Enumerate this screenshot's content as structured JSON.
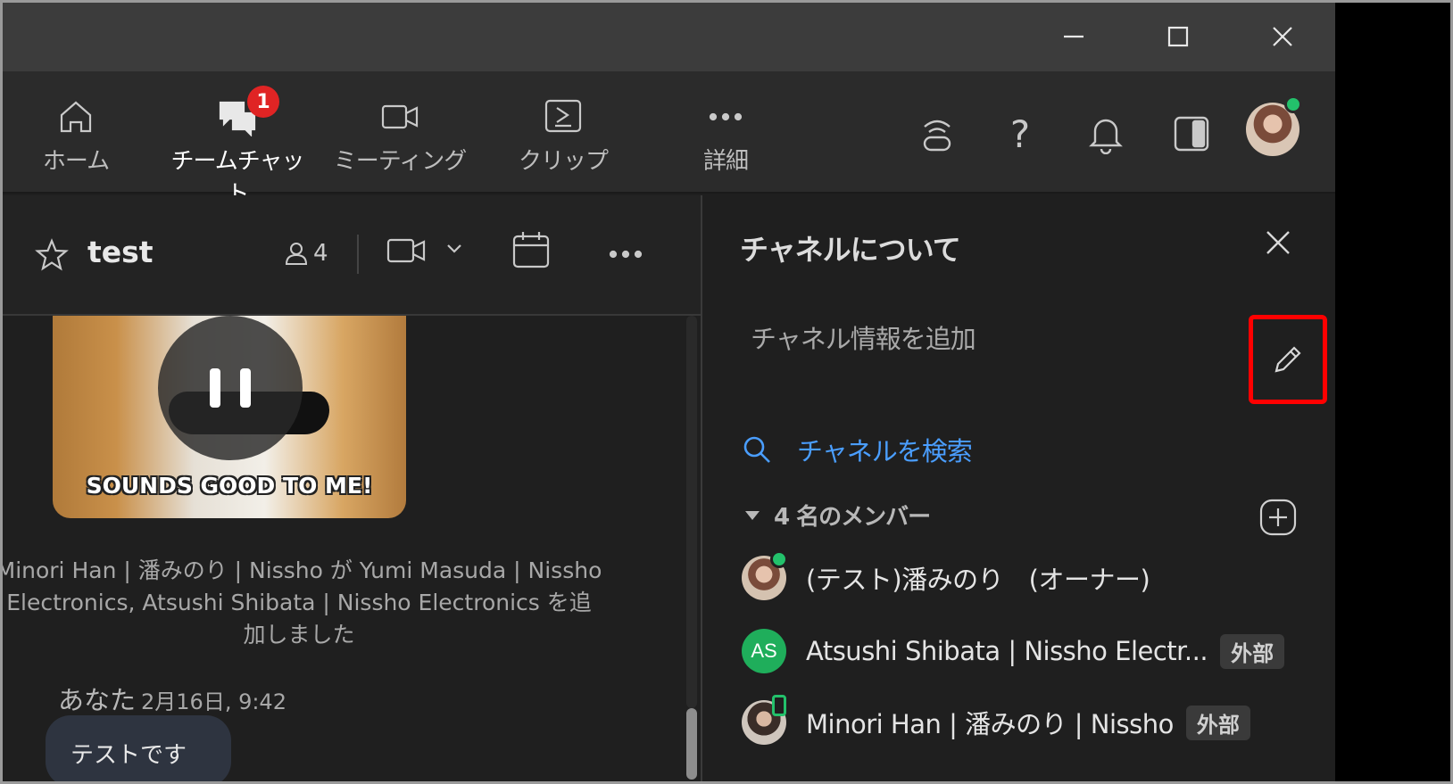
{
  "window_controls": {
    "minimize": "minimize-icon",
    "maximize": "maximize-icon",
    "close": "close-icon"
  },
  "nav": {
    "items": [
      {
        "label": "ホーム",
        "icon": "home-icon"
      },
      {
        "label": "チームチャット",
        "icon": "chat-icon",
        "badge": "1"
      },
      {
        "label": "ミーティング",
        "icon": "video-icon"
      },
      {
        "label": "クリップ",
        "icon": "clip-icon"
      },
      {
        "label": "詳細",
        "icon": "more-icon"
      }
    ],
    "help_glyph": "?"
  },
  "chat": {
    "title": "test",
    "member_count": "4",
    "gif_caption": "SOUNDS GOOD TO ME!",
    "system_message": "Minori Han | 潘みのり | Nissho が Yumi Masuda | Nissho Electronics,  Atsushi Shibata | Nissho Electronics を追加しました",
    "sender": "あなた",
    "timestamp": "2月16日, 9:42",
    "bubble_text": "テストです"
  },
  "side_panel": {
    "title": "チャネルについて",
    "add_info_placeholder": "チャネル情報を追加",
    "search_channel": "チャネルを検索",
    "members_header": "4 名のメンバー",
    "members": [
      {
        "name": "(テスト)潘みのり　(オーナー)",
        "avatar": "photo",
        "tag": ""
      },
      {
        "name": "Atsushi Shibata | Nissho Electr...",
        "avatar": "AS",
        "tag": "外部"
      },
      {
        "name": "Minori Han | 潘みのり | Nissho",
        "avatar": "photo",
        "tag": "外部"
      }
    ]
  },
  "colors": {
    "accent_link": "#4a9eff",
    "badge_red": "#e02424",
    "presence_green": "#23c16b",
    "highlight_box": "#ff0000"
  }
}
